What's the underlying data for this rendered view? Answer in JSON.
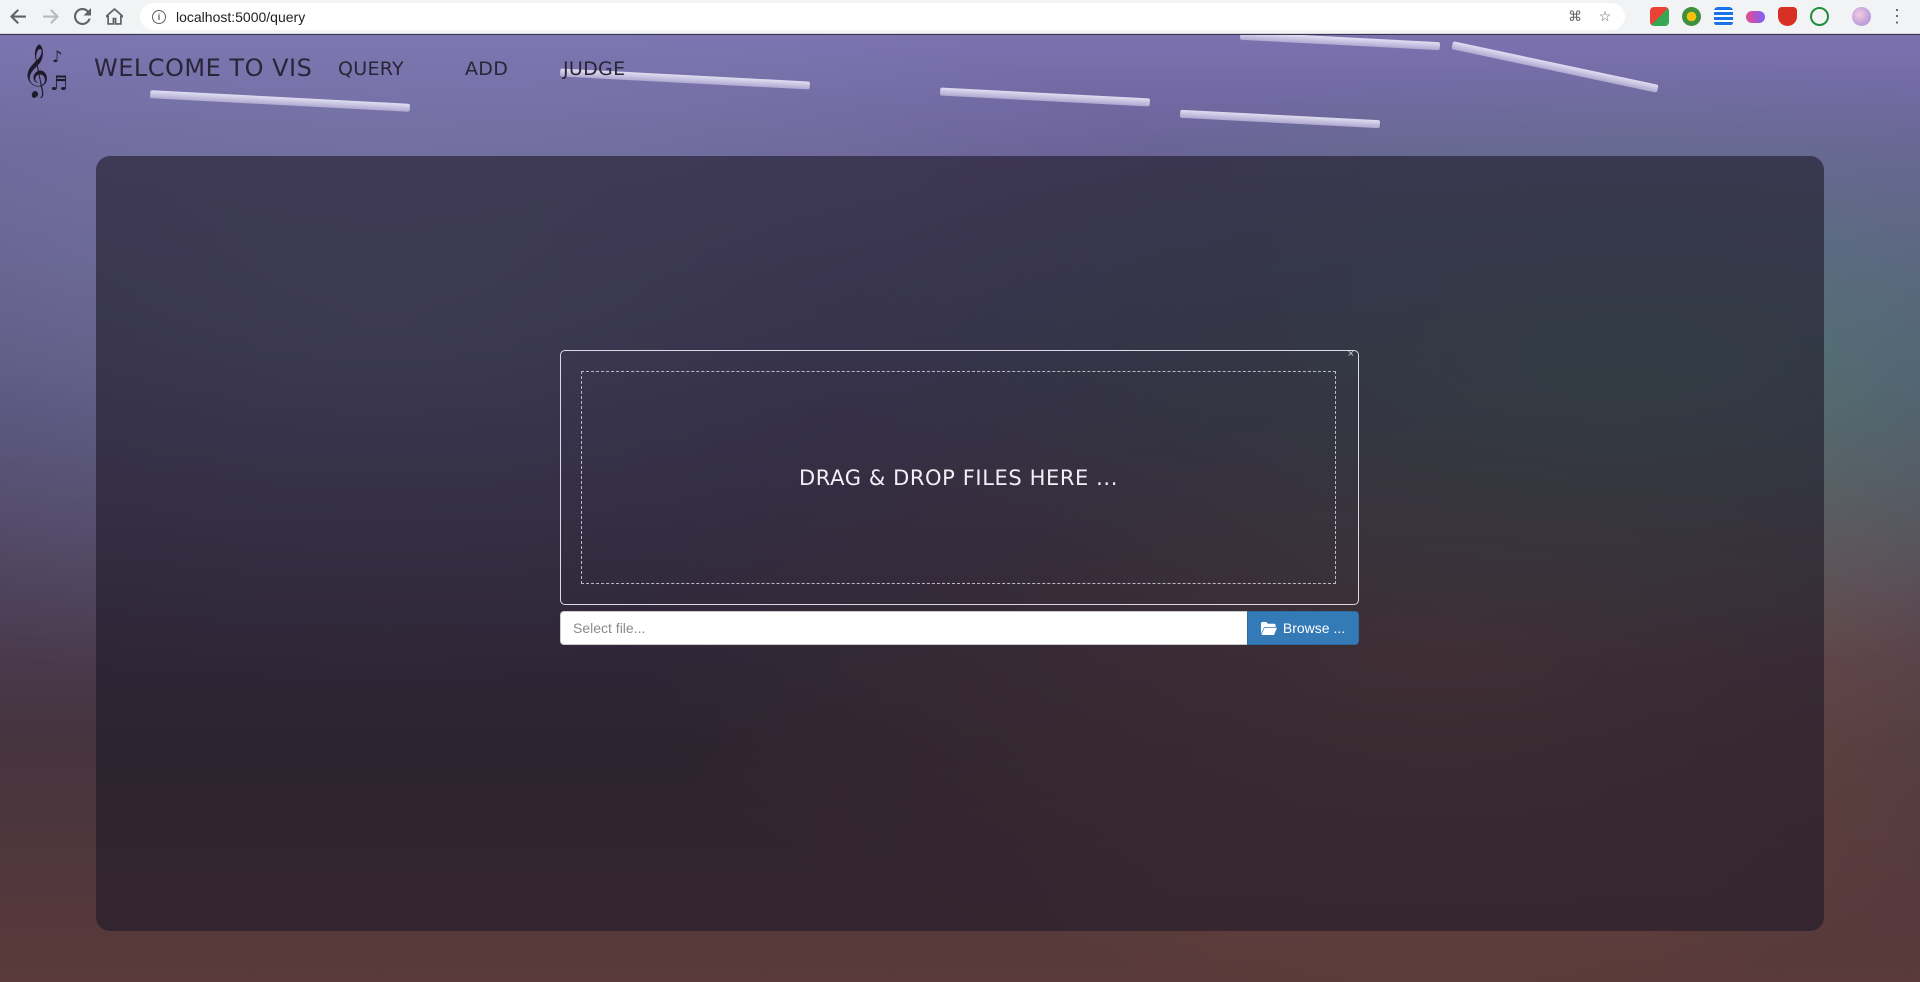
{
  "browser": {
    "url": "localhost:5000/query",
    "icons": [
      "back-icon",
      "forward-icon",
      "reload-icon",
      "home-icon",
      "info-icon",
      "translate-icon",
      "star-icon",
      "menu-icon"
    ]
  },
  "header": {
    "brand": "WELCOME TO VIS",
    "nav": [
      {
        "label": "QUERY"
      },
      {
        "label": "ADD"
      },
      {
        "label": "JUDGE"
      }
    ]
  },
  "upload": {
    "drop_text": "DRAG & DROP FILES HERE ...",
    "close_glyph": "×",
    "file_placeholder": "Select file...",
    "browse_label": "Browse ..."
  },
  "colors": {
    "browse_button": "#337ab7",
    "panel": "rgba(30,26,40,0.62)"
  }
}
